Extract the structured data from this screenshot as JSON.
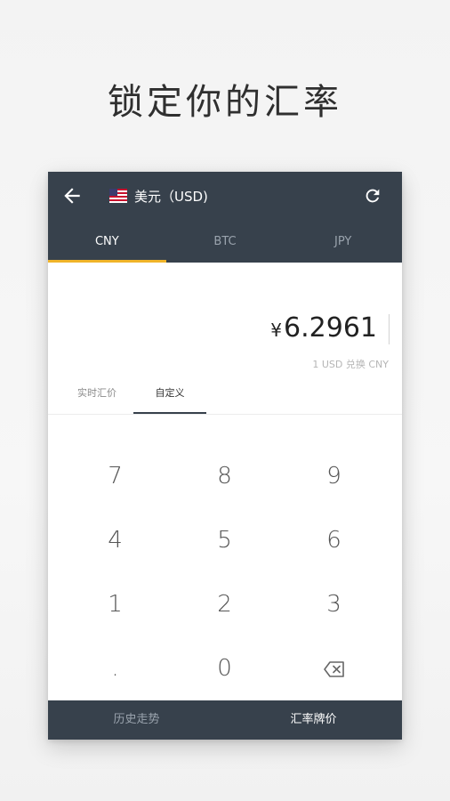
{
  "headline": "锁定你的汇率",
  "header": {
    "currency_title": "美元（USD)",
    "flag": "us-flag-icon"
  },
  "tabs": [
    {
      "label": "CNY",
      "active": true
    },
    {
      "label": "BTC",
      "active": false
    },
    {
      "label": "JPY",
      "active": false
    }
  ],
  "display": {
    "currency_symbol": "¥",
    "amount": "6.2961",
    "caption": "1 USD 兑换 CNY"
  },
  "subtabs": [
    {
      "label": "实时汇价",
      "active": false
    },
    {
      "label": "自定义",
      "active": true
    }
  ],
  "keypad": {
    "keys": [
      "7",
      "8",
      "9",
      "4",
      "5",
      "6",
      "1",
      "2",
      "3",
      ".",
      "0"
    ],
    "backspace": "backspace-icon"
  },
  "bottom_nav": [
    {
      "label": "历史走势",
      "active": false
    },
    {
      "label": "汇率牌价",
      "active": true
    }
  ],
  "colors": {
    "appbar": "#37414c",
    "accent": "#f0b429"
  }
}
